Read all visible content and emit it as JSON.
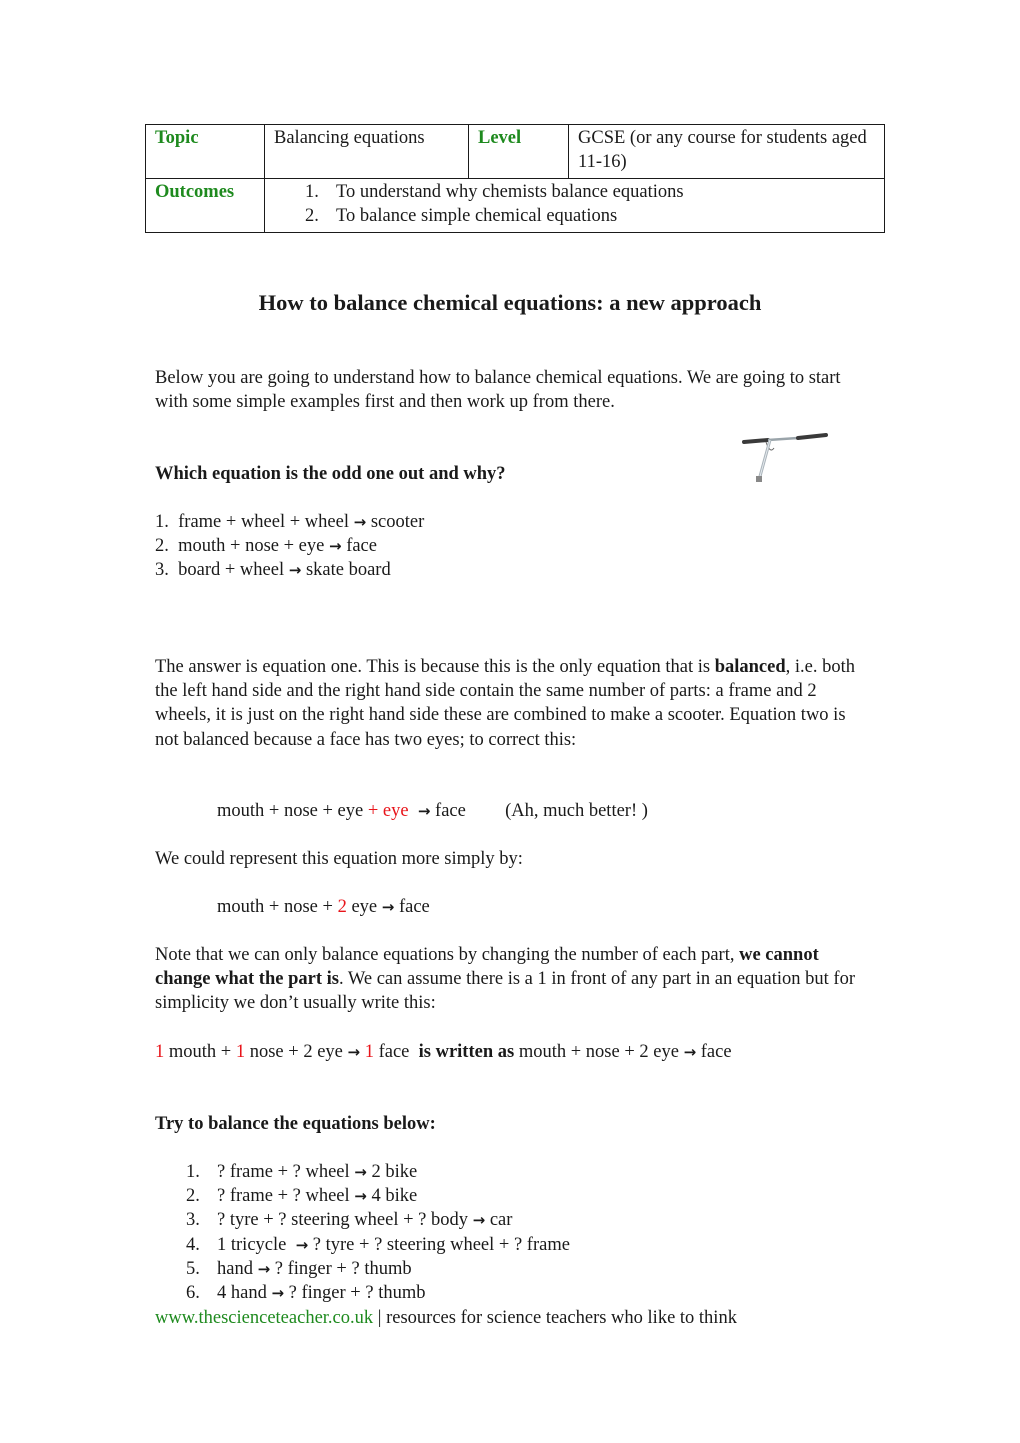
{
  "info_table": {
    "topic_label": "Topic",
    "topic_value": "Balancing equations",
    "level_label": "Level",
    "level_value": "GCSE (or any course for students aged 11-16)",
    "outcomes_label": "Outcomes",
    "outcomes": [
      {
        "num": "1.",
        "text": "To understand why chemists balance equations"
      },
      {
        "num": "2.",
        "text": "To balance simple chemical equations"
      }
    ]
  },
  "title": "How to balance chemical equations: a new approach",
  "intro": "Below you are going to understand how to balance chemical equations.  We are going to start with some simple examples first and then work up from there.",
  "question_heading": "Which equation is the odd one out and why?",
  "image_alt": "scooter handlebar",
  "odd_one_out": [
    {
      "num": "1.",
      "lhs": "frame + wheel + wheel",
      "rhs": "scooter"
    },
    {
      "num": "2.",
      "lhs": "mouth + nose + eye",
      "rhs": "face"
    },
    {
      "num": "3.",
      "lhs": "board + wheel",
      "rhs": "skate board"
    }
  ],
  "answer": {
    "part1": "The answer is equation one.  This is because this is the only equation that is ",
    "bold": "balanced",
    "part2": ", i.e. both the left hand side and the right hand side contain the same number of parts: a frame and 2 wheels, it is just on the right hand side these are combined to make a scooter.  Equation two is not balanced because a face has two eyes; to correct this:"
  },
  "corrected_eq": {
    "lhs": "mouth + nose + eye ",
    "added": "+ eye",
    "rhs": "face",
    "comment": "(Ah, much better! )"
  },
  "simpler_intro": "We could represent this equation more simply by:",
  "simpler_eq": {
    "pre": "mouth + nose + ",
    "coef": "2",
    "post": " eye",
    "rhs": "face"
  },
  "note": {
    "part1": "Note that we can only balance equations by changing the number of each part, ",
    "bold": "we cannot change what the part is",
    "part2": ".  We can assume there is a 1 in front of any part in an equation but for simplicity we don’t usually write this:"
  },
  "written_as": {
    "c1": "1",
    "t1": " mouth + ",
    "c2": "1",
    "t2": " nose + 2 eye ",
    "c3": "1",
    "t3": " face ",
    "bold": "is written as",
    "rest_lhs": " mouth + nose + 2 eye ",
    "rest_rhs": "face"
  },
  "try_heading": "Try to balance the equations below:",
  "exercises": [
    {
      "num": "1.",
      "lhs": "? frame + ? wheel",
      "rhs": "2 bike"
    },
    {
      "num": "2.",
      "lhs": "? frame + ? wheel",
      "rhs": "4 bike"
    },
    {
      "num": "3.",
      "lhs": "? tyre + ? steering wheel + ? body",
      "rhs": "car"
    },
    {
      "num": "4.",
      "lhs": "1 tricycle ",
      "rhs": "? tyre + ? steering wheel + ? frame"
    },
    {
      "num": "5.",
      "lhs": "hand",
      "rhs": "? finger + ? thumb"
    },
    {
      "num": "6.",
      "lhs": "4 hand",
      "rhs": "? finger + ? thumb"
    }
  ],
  "arrow_glyph": "→",
  "footer": {
    "link": "www.thescienceteacher.co.uk",
    "separator": " | ",
    "tagline": "resources for science teachers who like to think"
  },
  "colors": {
    "label_green": "#1e8a1e",
    "highlight_red": "#e8141a",
    "text": "#1a1a1a"
  }
}
